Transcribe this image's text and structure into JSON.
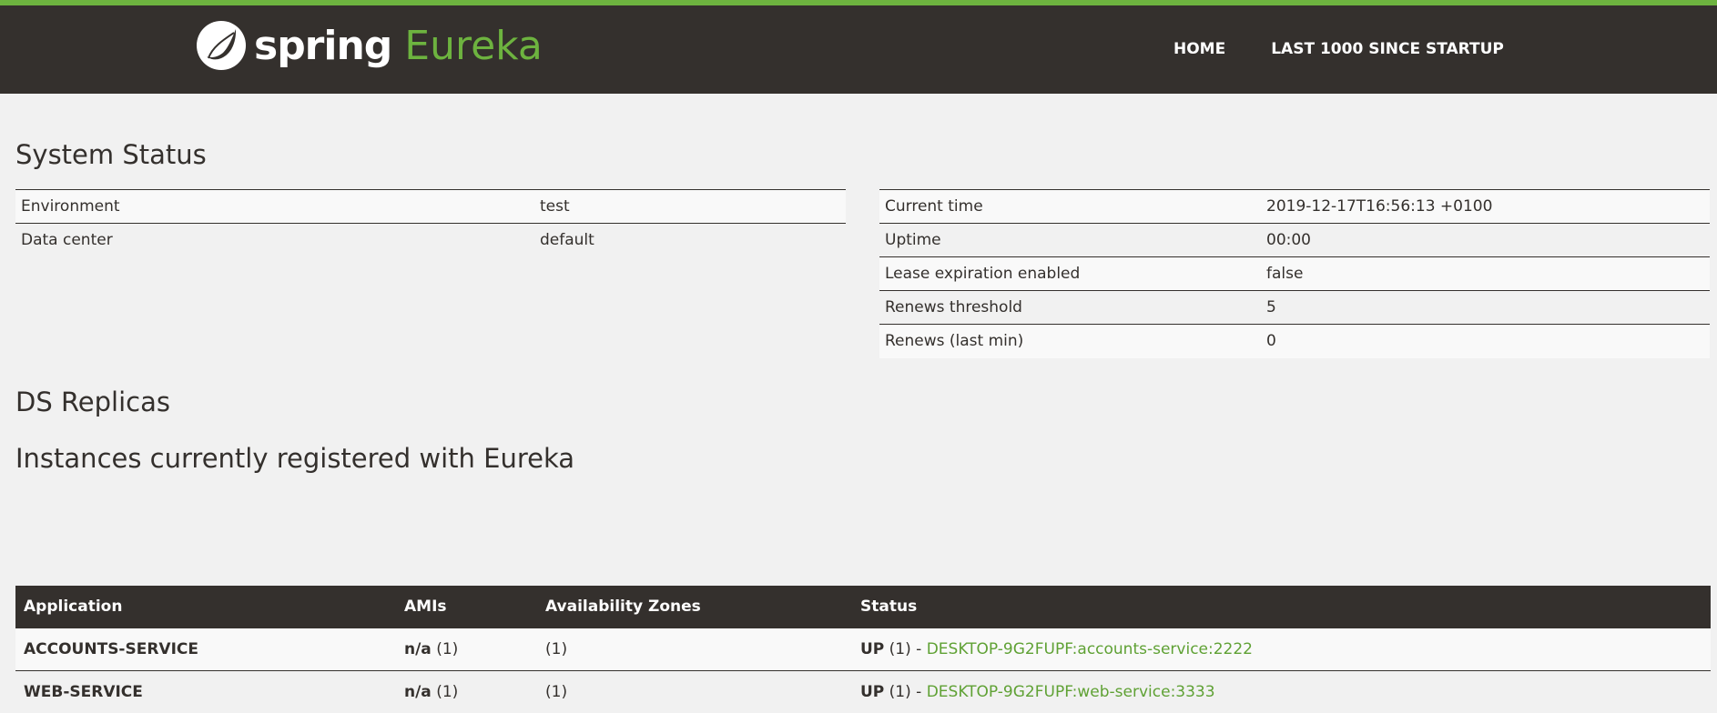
{
  "header": {
    "logo_spring": "spring",
    "logo_eureka": "Eureka",
    "nav": [
      {
        "label": "HOME"
      },
      {
        "label": "LAST 1000 SINCE STARTUP"
      }
    ]
  },
  "system_status": {
    "title": "System Status",
    "left": [
      {
        "label": "Environment",
        "value": "test"
      },
      {
        "label": "Data center",
        "value": "default"
      }
    ],
    "right": [
      {
        "label": "Current time",
        "value": "2019-12-17T16:56:13 +0100"
      },
      {
        "label": "Uptime",
        "value": "00:00"
      },
      {
        "label": "Lease expiration enabled",
        "value": "false"
      },
      {
        "label": "Renews threshold",
        "value": "5"
      },
      {
        "label": "Renews (last min)",
        "value": "0"
      }
    ]
  },
  "ds_replicas": {
    "title": "DS Replicas"
  },
  "instances": {
    "title": "Instances currently registered with Eureka",
    "headers": [
      "Application",
      "AMIs",
      "Availability Zones",
      "Status"
    ],
    "rows": [
      {
        "application": "ACCOUNTS-SERVICE",
        "ami_bold": "n/a",
        "ami_count": " (1)",
        "zones": "(1)",
        "status_bold": "UP",
        "status_count": " (1) - ",
        "instance_link": "DESKTOP-9G2FUPF:accounts-service:2222"
      },
      {
        "application": "WEB-SERVICE",
        "ami_bold": "n/a",
        "ami_count": " (1)",
        "zones": "(1)",
        "status_bold": "UP",
        "status_count": " (1) - ",
        "instance_link": "DESKTOP-9G2FUPF:web-service:3333"
      }
    ]
  },
  "colors": {
    "brand_green": "#6db33f",
    "header_bg": "#34302d",
    "link_green": "#5fa134",
    "page_bg": "#f1f1f1"
  }
}
